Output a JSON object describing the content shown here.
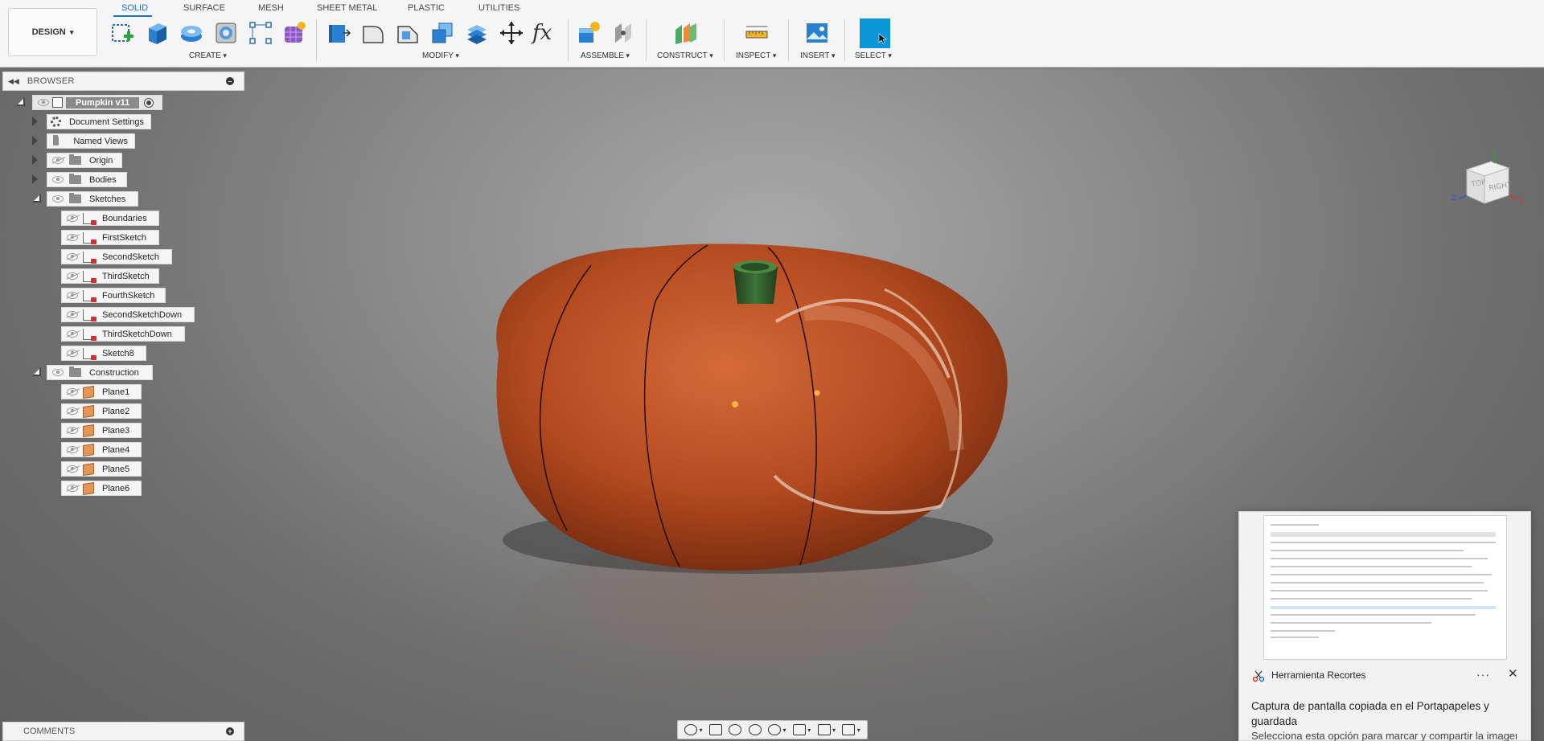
{
  "design_button": {
    "label": "DESIGN"
  },
  "tabs": [
    {
      "label": "SOLID",
      "active": true
    },
    {
      "label": "SURFACE"
    },
    {
      "label": "MESH"
    },
    {
      "label": "SHEET METAL"
    },
    {
      "label": "PLASTIC"
    },
    {
      "label": "UTILITIES"
    }
  ],
  "groups": {
    "create": "CREATE",
    "modify": "MODIFY",
    "assemble": "ASSEMBLE",
    "construct": "CONSTRUCT",
    "inspect": "INSPECT",
    "insert": "INSERT",
    "select": "SELECT"
  },
  "browser": {
    "title": "BROWSER",
    "root": "Pumpkin v11",
    "items": {
      "document_settings": "Document Settings",
      "named_views": "Named Views",
      "origin": "Origin",
      "bodies": "Bodies",
      "sketches": "Sketches",
      "construction": "Construction"
    },
    "sketches": [
      "Boundaries",
      "FirstSketch",
      "SecondSketch",
      "ThirdSketch",
      "FourthSketch",
      "SecondSketchDown",
      "ThirdSketchDown",
      "Sketch8"
    ],
    "planes": [
      "Plane1",
      "Plane2",
      "Plane3",
      "Plane4",
      "Plane5",
      "Plane6"
    ]
  },
  "viewcube": {
    "top_face": "TOP",
    "right_face": "RIGHT",
    "axis_x": "X",
    "axis_y": "Y",
    "axis_z": "Z"
  },
  "comments": {
    "title": "COMMENTS"
  },
  "notification": {
    "app": "Herramienta Recortes",
    "more": "···",
    "close": "✕",
    "title": "Captura de pantalla copiada en el Portapapeles y guardada",
    "body": "Selecciona esta opción para marcar y compartir la imagen."
  },
  "colors": {
    "accent": "#1a6fd0",
    "select_button": "#0b96d8",
    "pumpkin": "#b34a1f",
    "stem": "#2f5b2a"
  }
}
